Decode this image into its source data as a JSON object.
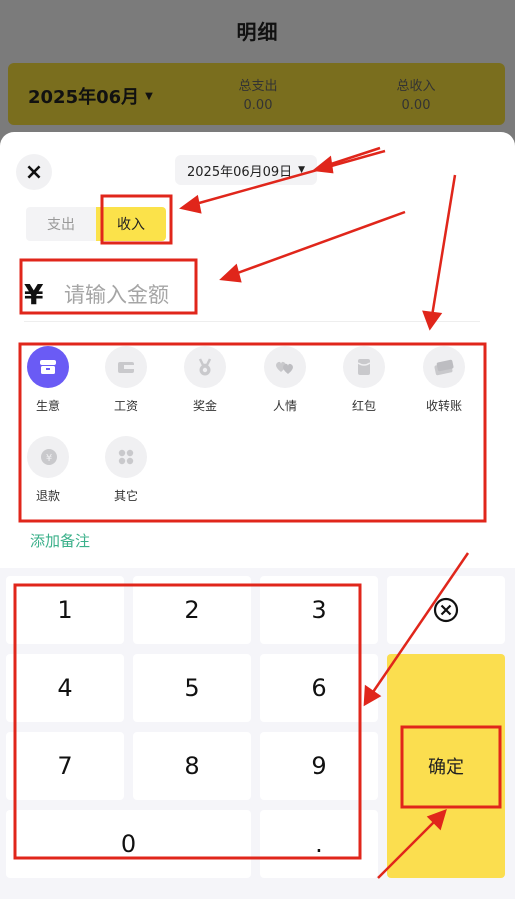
{
  "header": {
    "title": "明细"
  },
  "summary": {
    "month": "2025年06月",
    "expense_label": "总支出",
    "expense_value": "0.00",
    "income_label": "总收入",
    "income_value": "0.00"
  },
  "sheet": {
    "close_label": "×",
    "date": "2025年06月09日",
    "tabs": [
      {
        "label": "支出",
        "selected": false
      },
      {
        "label": "收入",
        "selected": true
      }
    ],
    "currency_symbol": "¥",
    "amount_placeholder": "请输入金额",
    "categories": [
      {
        "label": "生意",
        "icon": "shop-icon",
        "selected": true
      },
      {
        "label": "工资",
        "icon": "wallet-icon",
        "selected": false
      },
      {
        "label": "奖金",
        "icon": "medal-icon",
        "selected": false
      },
      {
        "label": "人情",
        "icon": "hearts-icon",
        "selected": false
      },
      {
        "label": "红包",
        "icon": "red-packet-icon",
        "selected": false
      },
      {
        "label": "收转账",
        "icon": "transfer-card-icon",
        "selected": false
      },
      {
        "label": "退款",
        "icon": "refund-icon",
        "selected": false
      },
      {
        "label": "其它",
        "icon": "grid-icon",
        "selected": false
      }
    ],
    "note_label": "添加备注"
  },
  "keypad": {
    "digits": [
      "1",
      "2",
      "3",
      "4",
      "5",
      "6",
      "7",
      "8",
      "9",
      "0",
      "."
    ],
    "delete_icon": "delete-circle-icon",
    "confirm_label": "确定"
  },
  "colors": {
    "accent_yellow": "#fbe24a",
    "category_selected": "#6a5bf5",
    "note_green": "#3bb08a",
    "annotation_red": "#e0261b"
  }
}
